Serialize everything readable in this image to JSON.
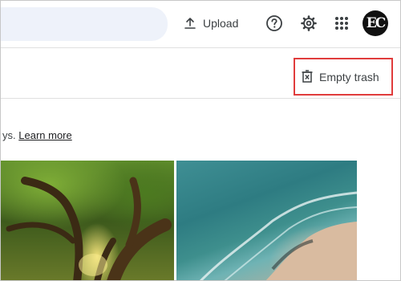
{
  "header": {
    "upload_label": "Upload",
    "avatar_initials": "EC"
  },
  "actions": {
    "empty_trash_label": "Empty trash"
  },
  "info": {
    "text": "ys.",
    "link_label": "Learn more"
  },
  "photos": [
    {
      "icon": "forest-tree-photo"
    },
    {
      "icon": "ocean-beach-aerial-photo"
    }
  ],
  "colors": {
    "search_bg": "#eef2fa",
    "highlight_border": "#e03c3c",
    "text": "#3c4043"
  }
}
